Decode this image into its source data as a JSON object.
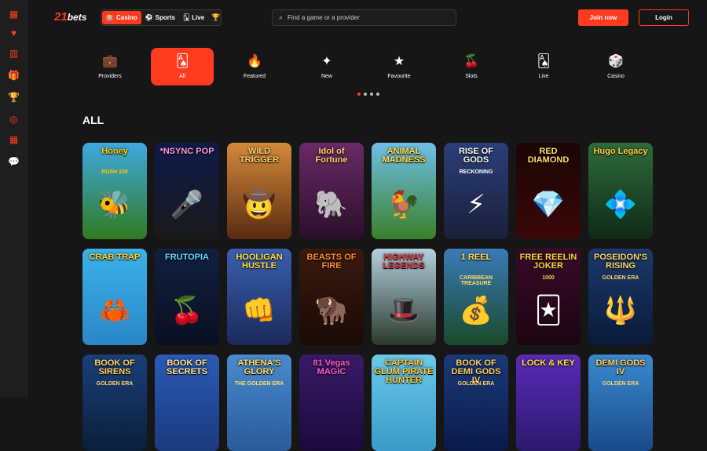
{
  "sidebar": {
    "items": [
      {
        "icon": "dashboard-icon",
        "glyph": "▦"
      },
      {
        "icon": "heart-icon",
        "glyph": "♥"
      },
      {
        "icon": "building-icon",
        "glyph": "▥"
      },
      {
        "icon": "gift-icon",
        "glyph": "🎁"
      },
      {
        "icon": "trophy-icon",
        "glyph": "🏆"
      },
      {
        "icon": "target-icon",
        "glyph": "◎"
      },
      {
        "icon": "grid-icon",
        "glyph": "▦"
      },
      {
        "icon": "chat-icon",
        "glyph": "💬"
      }
    ]
  },
  "header": {
    "logo_mark": "21",
    "logo_word": "bets",
    "tabs": [
      {
        "label": "Casino",
        "icon": "slot-icon",
        "glyph": "🎰"
      },
      {
        "label": "Sports",
        "icon": "ball-icon",
        "glyph": "⚽"
      },
      {
        "label": "Live",
        "icon": "cards-icon",
        "glyph": "🂡"
      }
    ],
    "search_placeholder": "Find a game or a provider",
    "join_label": "Join now",
    "login_label": "Login"
  },
  "categories": [
    {
      "label": "Providers",
      "glyph": "💼"
    },
    {
      "label": "All",
      "glyph": "🂡"
    },
    {
      "label": "Featured",
      "glyph": "🔥"
    },
    {
      "label": "New",
      "glyph": "✦"
    },
    {
      "label": "Favourite",
      "glyph": "★"
    },
    {
      "label": "Slots",
      "glyph": "🍒"
    },
    {
      "label": "Live",
      "glyph": "🂡"
    },
    {
      "label": "Casino",
      "glyph": "🎲"
    }
  ],
  "section_title": "ALL",
  "games": [
    {
      "title": "Honey",
      "sub": "RUSH 100",
      "art": "🐝",
      "bg1": "#3fa9e0",
      "bg2": "#2f7b1f",
      "color": "#ffcc00"
    },
    {
      "title": "*NSYNC POP",
      "sub": "",
      "art": "🎤",
      "bg1": "#0e1a4a",
      "bg2": "#1a1a1a",
      "color": "#ff9ad5"
    },
    {
      "title": "WILD TRIGGER",
      "sub": "",
      "art": "🤠",
      "bg1": "#d48a3a",
      "bg2": "#5a2b10",
      "color": "#ffd36b"
    },
    {
      "title": "Idol of Fortune",
      "sub": "",
      "art": "🐘",
      "bg1": "#6a2a66",
      "bg2": "#2a0f2a",
      "color": "#ffd36b"
    },
    {
      "title": "ANIMAL MADNESS",
      "sub": "",
      "art": "🐓",
      "bg1": "#6ec0e8",
      "bg2": "#3a7f28",
      "color": "#ffe14d"
    },
    {
      "title": "RISE OF GODS",
      "sub": "RECKONING",
      "art": "⚡",
      "bg1": "#2a3f7a",
      "bg2": "#1a1f3a",
      "color": "#ffffff"
    },
    {
      "title": "RED DIAMOND",
      "sub": "",
      "art": "💎",
      "bg1": "#1a0505",
      "bg2": "#3a0808",
      "color": "#ffe066"
    },
    {
      "title": "Hugo Legacy",
      "sub": "",
      "art": "💠",
      "bg1": "#2f6b3a",
      "bg2": "#0f2a18",
      "color": "#ffd33a"
    },
    {
      "title": "CRAB TRAP",
      "sub": "",
      "art": "🦀",
      "bg1": "#3bb2ea",
      "bg2": "#2a86c8",
      "color": "#ffd83a"
    },
    {
      "title": "FRUTOPIA",
      "sub": "",
      "art": "🍒",
      "bg1": "#102040",
      "bg2": "#0a0f22",
      "color": "#6ad8ff"
    },
    {
      "title": "HOOLIGAN HUSTLE",
      "sub": "",
      "art": "👊",
      "bg1": "#3a5fb0",
      "bg2": "#1a2a5a",
      "color": "#ffe04a"
    },
    {
      "title": "BEASTS OF FIRE",
      "sub": "",
      "art": "🦬",
      "bg1": "#3a1a10",
      "bg2": "#1a0a05",
      "color": "#ff8a2a"
    },
    {
      "title": "HIGHWAY LEGENDS",
      "sub": "",
      "art": "🎩",
      "bg1": "#b4d0e0",
      "bg2": "#2a3a2a",
      "color": "#d8343a"
    },
    {
      "title": "1 REEL",
      "sub": "CARIBBEAN TREASURE",
      "art": "💰",
      "bg1": "#3a7ab8",
      "bg2": "#1a4a2a",
      "color": "#ffe066"
    },
    {
      "title": "FREE REELIN JOKER",
      "sub": "1000",
      "art": "🃏",
      "bg1": "#3a0a2a",
      "bg2": "#1a0510",
      "color": "#ffd33a"
    },
    {
      "title": "POSEIDON'S RISING",
      "sub": "GOLDEN ERA",
      "art": "🔱",
      "bg1": "#1a3a6a",
      "bg2": "#0a1a3a",
      "color": "#ffd56a"
    },
    {
      "title": "BOOK OF SIRENS",
      "sub": "GOLDEN ERA",
      "art": "",
      "bg1": "#1a3f7a",
      "bg2": "#0a1f3a",
      "color": "#ffd56a"
    },
    {
      "title": "BOOK OF SECRETS",
      "sub": "",
      "art": "",
      "bg1": "#2a5ab8",
      "bg2": "#1a3a7a",
      "color": "#ffe7a0"
    },
    {
      "title": "ATHENA'S GLORY",
      "sub": "THE GOLDEN ERA",
      "art": "",
      "bg1": "#4a8ad0",
      "bg2": "#2a5a9a",
      "color": "#ffe066"
    },
    {
      "title": "81 Vegas MAGIC",
      "sub": "",
      "art": "",
      "bg1": "#3a1a6a",
      "bg2": "#1a0a3a",
      "color": "#ff5ad0"
    },
    {
      "title": "CAPTAIN GLUM PIRATE HUNTER",
      "sub": "",
      "art": "",
      "bg1": "#6ac8e8",
      "bg2": "#3a9ac8",
      "color": "#ffcc33"
    },
    {
      "title": "BOOK OF DEMI GODS IV",
      "sub": "GOLDEN ERA",
      "art": "",
      "bg1": "#1a3a7a",
      "bg2": "#0a1a4a",
      "color": "#ffd56a"
    },
    {
      "title": "LOCK & KEY",
      "sub": "",
      "art": "",
      "bg1": "#5a2ab8",
      "bg2": "#2a1a6a",
      "color": "#ffe24a"
    },
    {
      "title": "DEMI GODS IV",
      "sub": "GOLDEN ERA",
      "art": "",
      "bg1": "#3a8ad0",
      "bg2": "#1a4a8a",
      "color": "#ffd56a"
    }
  ]
}
